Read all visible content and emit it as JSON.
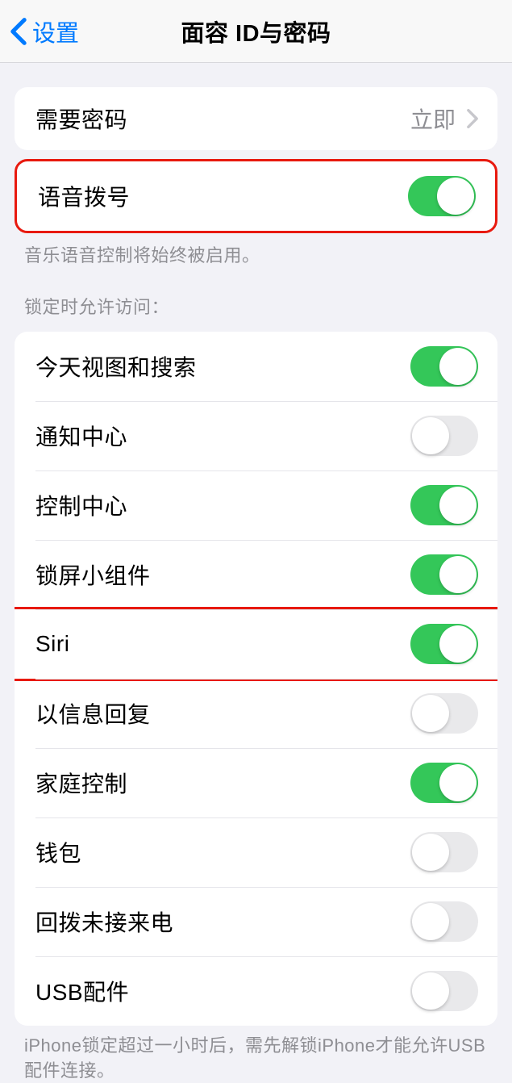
{
  "nav": {
    "back_label": "设置",
    "title": "面容 ID与密码"
  },
  "passcode": {
    "label": "需要密码",
    "value": "立即"
  },
  "voice_dial": {
    "label": "语音拨号",
    "on": true,
    "footer": "音乐语音控制将始终被启用。"
  },
  "lock_access": {
    "header": "锁定时允许访问：",
    "items": [
      {
        "label": "今天视图和搜索",
        "on": true
      },
      {
        "label": "通知中心",
        "on": false
      },
      {
        "label": "控制中心",
        "on": true
      },
      {
        "label": "锁屏小组件",
        "on": true
      },
      {
        "label": "Siri",
        "on": true,
        "highlight": true
      },
      {
        "label": "以信息回复",
        "on": false
      },
      {
        "label": "家庭控制",
        "on": true
      },
      {
        "label": "钱包",
        "on": false
      },
      {
        "label": "回拨未接来电",
        "on": false
      },
      {
        "label": "USB配件",
        "on": false
      }
    ],
    "footer": "iPhone锁定超过一小时后，需先解锁iPhone才能允许USB 配件连接。"
  }
}
